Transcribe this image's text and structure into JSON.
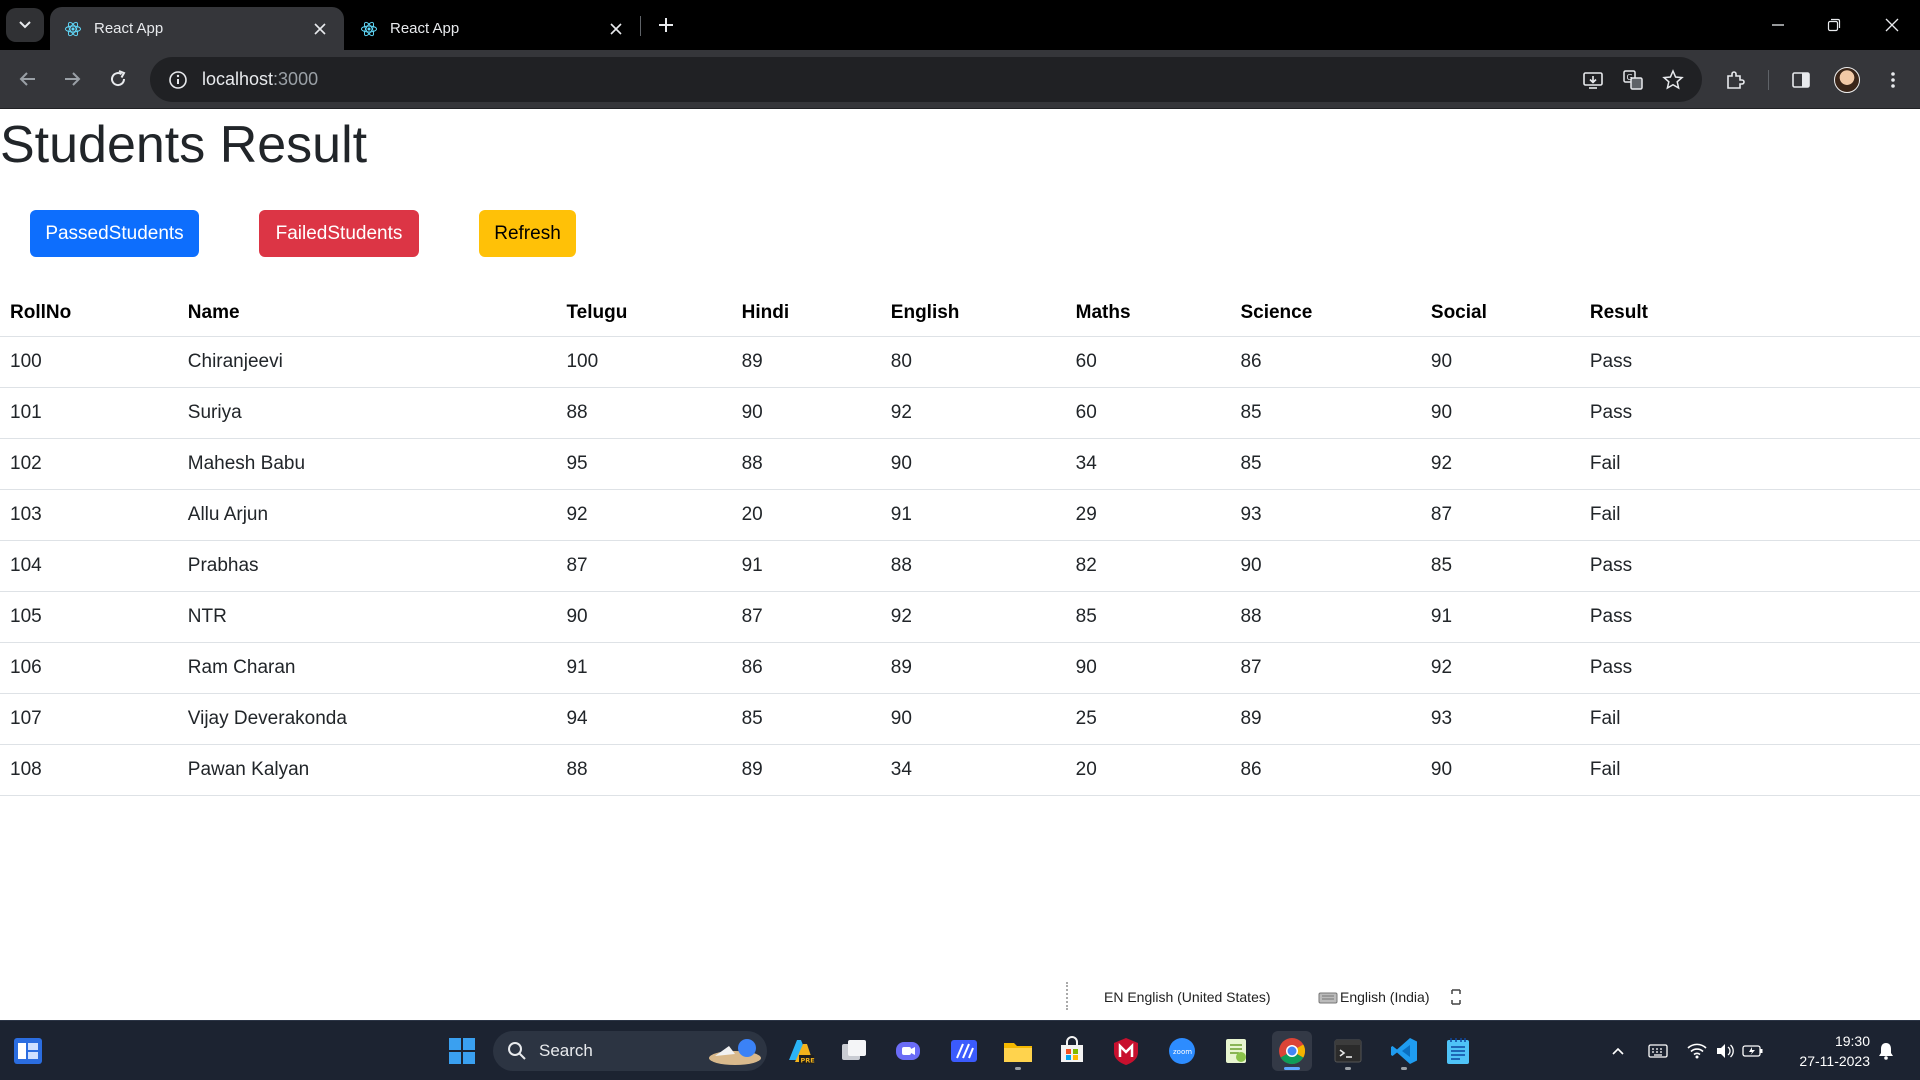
{
  "browser": {
    "tabs": [
      {
        "title": "React App",
        "active": true
      },
      {
        "title": "React App",
        "active": false
      }
    ],
    "url_host": "localhost",
    "url_port": ":3000"
  },
  "page": {
    "title": "Students Result",
    "buttons": {
      "passed": "PassedStudents",
      "failed": "FailedStudents",
      "refresh": "Refresh"
    },
    "colors": {
      "primary": "#0d6efd",
      "danger": "#dc3545",
      "warning": "#ffc107"
    },
    "table": {
      "headers": [
        "RollNo",
        "Name",
        "Telugu",
        "Hindi",
        "English",
        "Maths",
        "Science",
        "Social",
        "Result"
      ],
      "rows": [
        [
          "100",
          "Chiranjeevi",
          "100",
          "89",
          "80",
          "60",
          "86",
          "90",
          "Pass"
        ],
        [
          "101",
          "Suriya",
          "88",
          "90",
          "92",
          "60",
          "85",
          "90",
          "Pass"
        ],
        [
          "102",
          "Mahesh Babu",
          "95",
          "88",
          "90",
          "34",
          "85",
          "92",
          "Fail"
        ],
        [
          "103",
          "Allu Arjun",
          "92",
          "20",
          "91",
          "29",
          "93",
          "87",
          "Fail"
        ],
        [
          "104",
          "Prabhas",
          "87",
          "91",
          "88",
          "82",
          "90",
          "85",
          "Pass"
        ],
        [
          "105",
          "NTR",
          "90",
          "87",
          "92",
          "85",
          "88",
          "91",
          "Pass"
        ],
        [
          "106",
          "Ram Charan",
          "91",
          "86",
          "89",
          "90",
          "87",
          "92",
          "Pass"
        ],
        [
          "107",
          "Vijay Deverakonda",
          "94",
          "85",
          "90",
          "25",
          "89",
          "93",
          "Fail"
        ],
        [
          "108",
          "Pawan Kalyan",
          "88",
          "89",
          "34",
          "20",
          "86",
          "90",
          "Fail"
        ]
      ]
    }
  },
  "language_bar": {
    "input_language": "EN English (United States)",
    "keyboard": "English (India)"
  },
  "taskbar": {
    "search_label": "Search",
    "time": "19:30",
    "date": "27-11-2023"
  }
}
